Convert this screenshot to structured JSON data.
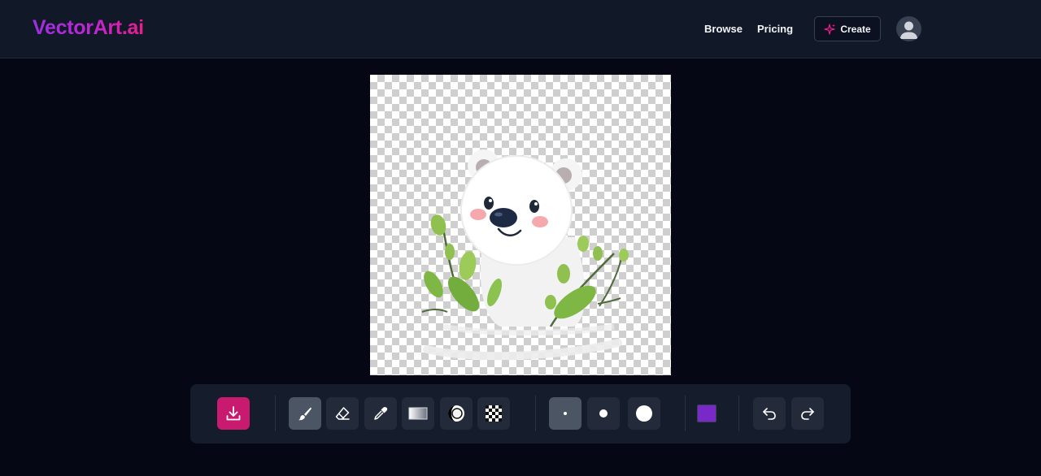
{
  "header": {
    "logo": "VectorArt.ai",
    "nav": {
      "browse": "Browse",
      "pricing": "Pricing"
    },
    "create_label": "Create",
    "icons": {
      "create": "sparkle-icon",
      "avatar": "user-avatar-icon"
    }
  },
  "canvas": {
    "image": "polar-bear-with-leaves-illustration",
    "background": "transparent-checkerboard"
  },
  "toolbar": {
    "download": "download-icon",
    "tools": [
      "brush-icon",
      "eraser-icon",
      "eyedropper-icon",
      "gradient-icon",
      "blur-icon",
      "transparency-icon"
    ],
    "active_tool": "brush",
    "brush_sizes": [
      "small",
      "medium",
      "large"
    ],
    "active_brush_size": "small",
    "color": "#7a29c9",
    "history": [
      "undo-icon",
      "redo-icon"
    ]
  },
  "colors": {
    "accent": "#c81a6f",
    "logo_from": "#9d2fe0",
    "logo_to": "#e91e8c"
  }
}
